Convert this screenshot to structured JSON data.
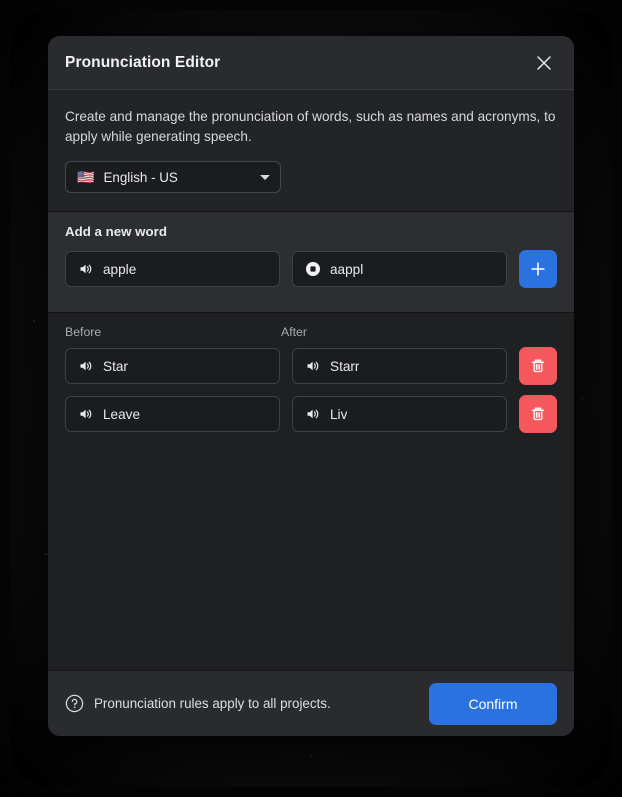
{
  "dialog": {
    "title": "Pronunciation Editor",
    "close_icon": "close-icon",
    "description": "Create and manage the pronunciation of words, such as names and acronyms, to apply while generating speech.",
    "language": {
      "flag": "🇺🇸",
      "label": "English - US",
      "caret_icon": "chevron-down-icon"
    },
    "add_section": {
      "label": "Add a new word",
      "word_field": {
        "value": "apple",
        "placeholder": "apple",
        "icon": "speaker-icon"
      },
      "pronunciation_field": {
        "value": "aappl",
        "placeholder": "aappl",
        "icon": "stop-record-icon"
      },
      "add_button_icon": "plus-icon"
    },
    "columns": {
      "before": "Before",
      "after": "After"
    },
    "rules": [
      {
        "before": "Star",
        "after": "Starr",
        "before_icon": "speaker-icon",
        "after_icon": "speaker-icon",
        "delete_icon": "trash-icon"
      },
      {
        "before": "Leave",
        "after": "Liv",
        "before_icon": "speaker-icon",
        "after_icon": "speaker-icon",
        "delete_icon": "trash-icon"
      }
    ],
    "footer": {
      "help_icon": "help-circle-icon",
      "note": "Pronunciation rules apply to all projects.",
      "confirm_label": "Confirm"
    }
  },
  "colors": {
    "accent_blue": "#2a72e0",
    "danger_red": "#f4585c",
    "dialog_bg": "#1f2022",
    "header_bg": "#2a2b2e",
    "band_bg": "#2d2e32"
  }
}
